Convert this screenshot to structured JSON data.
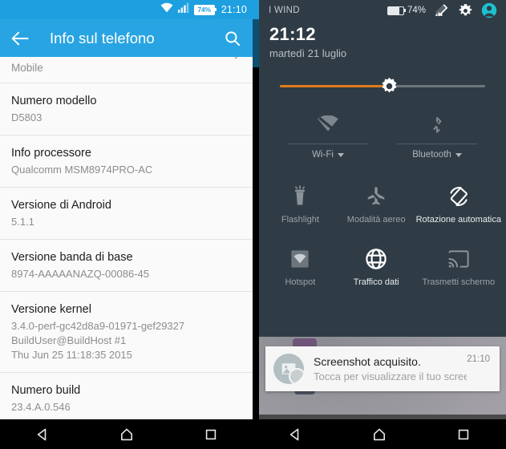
{
  "left_panel": {
    "statusbar": {
      "wifi_icon": "wifi-icon",
      "signal_icon": "signal-bars-icon",
      "battery_level": "74%",
      "time": "21:10"
    },
    "appbar": {
      "back_icon": "back-arrow-icon",
      "title": "Info sul telefono",
      "search_icon": "search-icon"
    },
    "clipped_row": {
      "text": "Invia dati anonimi e statistiche di utilizzo a Sony Mobile"
    },
    "rows": [
      {
        "title": "Numero modello",
        "sub": [
          "D5803"
        ]
      },
      {
        "title": "Info processore",
        "sub": [
          "Qualcomm MSM8974PRO-AC"
        ]
      },
      {
        "title": "Versione di Android",
        "sub": [
          "5.1.1"
        ]
      },
      {
        "title": "Versione banda di base",
        "sub": [
          "8974-AAAAANAZQ-00086-45"
        ]
      },
      {
        "title": "Versione kernel",
        "sub": [
          "3.4.0-perf-gc42d8a9-01971-gef29327",
          "BuildUser@BuildHost #1",
          "Thu Jun 25 11:18:35 2015"
        ]
      },
      {
        "title": "Numero build",
        "sub": [
          "23.4.A.0.546"
        ]
      }
    ]
  },
  "right_panel": {
    "statusbar": {
      "carrier": "I WIND",
      "battery_level": "74%",
      "edit_icon": "stats-edit-icon",
      "settings_icon": "gear-icon",
      "user_icon": "user-avatar-icon"
    },
    "clock": {
      "time": "21:12",
      "date": "martedì 21 luglio"
    },
    "brightness": {
      "icon": "brightness-sun-icon",
      "value_percent": 53
    },
    "toggles": [
      {
        "label": "Wi-Fi",
        "icon": "wifi-off-icon",
        "state": "off",
        "has_caret": true
      },
      {
        "label": "Bluetooth",
        "icon": "bluetooth-off-icon",
        "state": "off",
        "has_caret": true
      }
    ],
    "tiles": [
      {
        "label": "Flashlight",
        "icon": "flashlight-icon",
        "state": "off"
      },
      {
        "label": "Modalità aereo",
        "icon": "airplane-icon",
        "state": "off"
      },
      {
        "label": "Rotazione automatica",
        "icon": "auto-rotate-icon",
        "state": "on"
      },
      {
        "label": "Hotspot",
        "icon": "hotspot-icon",
        "state": "off"
      },
      {
        "label": "Traffico dati",
        "icon": "data-globe-icon",
        "state": "on"
      },
      {
        "label": "Trasmetti schermo",
        "icon": "cast-screen-icon",
        "state": "off"
      }
    ],
    "notification": {
      "icon": "screenshot-image-icon",
      "title": "Screenshot acquisito.",
      "subtitle": "Tocca per visualizzare il tuo screenshot.",
      "time": "21:10"
    }
  },
  "navbar": {
    "back_icon": "nav-back-icon",
    "home_icon": "nav-home-icon",
    "recents_icon": "nav-recents-icon"
  },
  "colors": {
    "status_blue": "#1e9fe0",
    "appbar_blue": "#29a4e2",
    "shade_dark": "#2f3c45",
    "brightness_orange": "#e07b20",
    "accent_cyan": "#1ec0d0"
  }
}
